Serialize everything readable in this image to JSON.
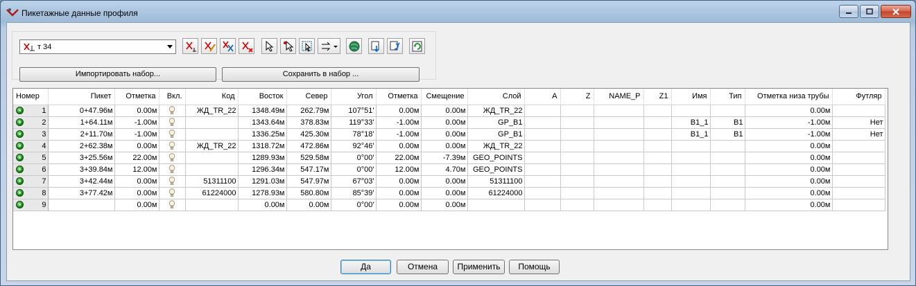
{
  "window": {
    "title": "Пикетажные данные профиля"
  },
  "toolbar": {
    "set_select": {
      "value": "т 34"
    },
    "import_button": "Импортировать набор...",
    "save_button": "Сохранить в набор ...",
    "tool_icons": [
      "point-add-icon",
      "point-edit-icon",
      "point-group-icon",
      "point-delete-icon",
      "pick-point-icon",
      "select-point-icon",
      "select-region-icon",
      "direction-dropdown-icon",
      "globe-icon",
      "import-down-icon",
      "export-icon",
      "refresh-icon"
    ]
  },
  "grid": {
    "columns": [
      "Номер",
      "Пикет",
      "Отметка",
      "Вкл.",
      "Код",
      "Восток",
      "Север",
      "Угол",
      "Отметка",
      "Смещение",
      "Слой",
      "A",
      "Z",
      "NAME_P",
      "Z1",
      "Имя",
      "Тип",
      "Отметка низа трубы",
      "Футляр"
    ],
    "rows": [
      {
        "num": "1",
        "piket": "0+47.96м",
        "elev": "0.00м",
        "code": "ЖД_TR_22",
        "east": "1348.49м",
        "north": "262.79м",
        "angle": "107°51'",
        "elev2": "0.00м",
        "offset": "0.00м",
        "layer": "ЖД_TR_22",
        "a": "",
        "z": "",
        "name_p": "",
        "z1": "",
        "name": "",
        "type": "",
        "pipe": "0.00м",
        "case": ""
      },
      {
        "num": "2",
        "piket": "1+64.11м",
        "elev": "-1.00м",
        "code": "",
        "east": "1343.64м",
        "north": "378.83м",
        "angle": "119°33'",
        "elev2": "-1.00м",
        "offset": "0.00м",
        "layer": "GP_B1",
        "a": "",
        "z": "",
        "name_p": "",
        "z1": "",
        "name": "B1_1",
        "type": "B1",
        "pipe": "-1.00м",
        "case": "Нет"
      },
      {
        "num": "3",
        "piket": "2+11.70м",
        "elev": "-1.00м",
        "code": "",
        "east": "1336.25м",
        "north": "425.30м",
        "angle": "78°18'",
        "elev2": "-1.00м",
        "offset": "0.00м",
        "layer": "GP_B1",
        "a": "",
        "z": "",
        "name_p": "",
        "z1": "",
        "name": "B1_1",
        "type": "B1",
        "pipe": "-1.00м",
        "case": "Нет"
      },
      {
        "num": "4",
        "piket": "2+62.38м",
        "elev": "0.00м",
        "code": "ЖД_TR_22",
        "east": "1318.72м",
        "north": "472.86м",
        "angle": "92°46'",
        "elev2": "0.00м",
        "offset": "0.00м",
        "layer": "ЖД_TR_22",
        "a": "",
        "z": "",
        "name_p": "",
        "z1": "",
        "name": "",
        "type": "",
        "pipe": "0.00м",
        "case": ""
      },
      {
        "num": "5",
        "piket": "3+25.56м",
        "elev": "22.00м",
        "code": "",
        "east": "1289.93м",
        "north": "529.58м",
        "angle": "0°00'",
        "elev2": "22.00м",
        "offset": "-7.39м",
        "layer": "GEO_POINTS",
        "a": "",
        "z": "",
        "name_p": "",
        "z1": "",
        "name": "",
        "type": "",
        "pipe": "0.00м",
        "case": ""
      },
      {
        "num": "6",
        "piket": "3+39.84м",
        "elev": "12.00м",
        "code": "",
        "east": "1296.34м",
        "north": "547.17м",
        "angle": "0°00'",
        "elev2": "12.00м",
        "offset": "4.70м",
        "layer": "GEO_POINTS",
        "a": "",
        "z": "",
        "name_p": "",
        "z1": "",
        "name": "",
        "type": "",
        "pipe": "0.00м",
        "case": ""
      },
      {
        "num": "7",
        "piket": "3+42.44м",
        "elev": "0.00м",
        "code": "51311100",
        "east": "1291.03м",
        "north": "547.97м",
        "angle": "67°03'",
        "elev2": "0.00м",
        "offset": "0.00м",
        "layer": "51311100",
        "a": "",
        "z": "",
        "name_p": "",
        "z1": "",
        "name": "",
        "type": "",
        "pipe": "0.00м",
        "case": ""
      },
      {
        "num": "8",
        "piket": "3+77.42м",
        "elev": "0.00м",
        "code": "61224000",
        "east": "1278.93м",
        "north": "580.80м",
        "angle": "85°39'",
        "elev2": "0.00м",
        "offset": "0.00м",
        "layer": "61224000",
        "a": "",
        "z": "",
        "name_p": "",
        "z1": "",
        "name": "",
        "type": "",
        "pipe": "0.00м",
        "case": ""
      },
      {
        "num": "9",
        "piket": "",
        "elev": "0.00м",
        "code": "",
        "east": "0.00м",
        "north": "0.00м",
        "angle": "0°00'",
        "elev2": "0.00м",
        "offset": "0.00м",
        "layer": "",
        "a": "",
        "z": "",
        "name_p": "",
        "z1": "",
        "name": "",
        "type": "",
        "pipe": "0.00м",
        "case": ""
      }
    ]
  },
  "footer": {
    "ok": "Да",
    "cancel": "Отмена",
    "apply": "Применить",
    "help": "Помощь"
  }
}
